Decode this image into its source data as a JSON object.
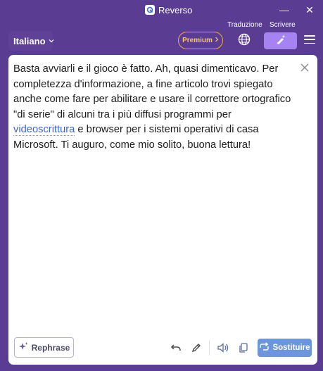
{
  "window": {
    "title": "Reverso",
    "minimize_symbol": "—",
    "close_symbol": "✕"
  },
  "toolbar": {
    "language": "Italiano",
    "premium_label": "Premium",
    "translate_label": "Traduzione",
    "write_label": "Scrivere"
  },
  "editor": {
    "text_before_link": "Basta avviarli e il gioco è fatto. Ah, quasi dimenticavo. Per completezza d'informazione, a fine articolo trovi spiegato anche come fare per abilitare e usare il correttore ortografico \"di serie\" di alcuni tra i più diffusi programmi per ",
    "link_word": "videoscrittura",
    "text_after_link": " e browser per i sistemi operativi di casa Microsoft.  Ti auguro, come mio solito, buona lettura!"
  },
  "bottom_bar": {
    "rephrase_label": "Rephrase",
    "replace_label": "Sostituire"
  },
  "colors": {
    "window_bg": "#5a3c93",
    "accent_purple": "#a583f3",
    "premium_orange": "#f0a84a",
    "replace_blue": "#6b95dc",
    "link_blue": "#3a68c4"
  },
  "icons": {
    "app_logo": "reverso-logo-icon",
    "globe": "globe-icon",
    "write": "pen-sparkle-icon",
    "menu": "hamburger-icon",
    "clear": "close-icon",
    "rephrase": "sparkle-icon",
    "undo": "undo-icon",
    "edit": "pencil-icon",
    "speaker": "speaker-icon",
    "copy": "copy-icon",
    "replace": "replace-icon"
  }
}
